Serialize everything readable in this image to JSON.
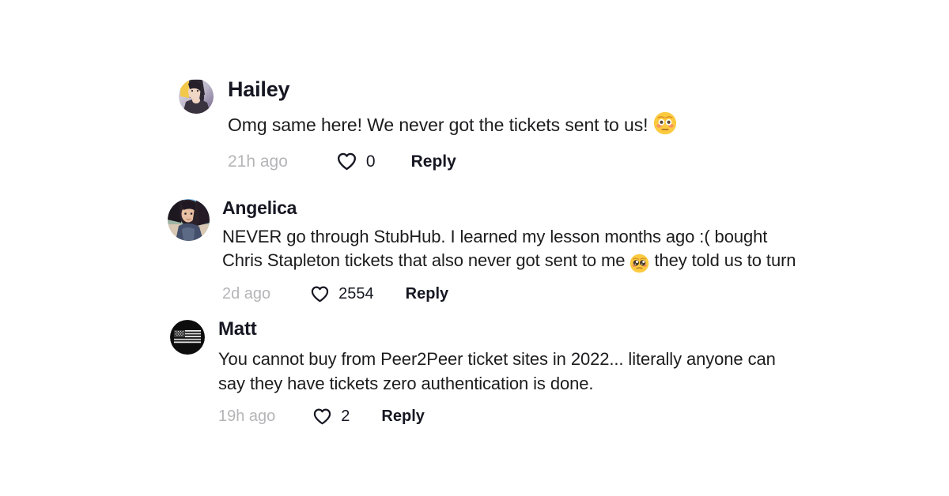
{
  "theme": {
    "background": "#ffffff",
    "author_color": "#161722",
    "text_color": "#1c1c1e",
    "timestamp_color": "#b5b5b8",
    "action_color": "#161722"
  },
  "comments": [
    {
      "author": "Hailey",
      "avatar": "photo-portrait-blonde-dark-avatar",
      "text_before_emoji": "Omg same here! We never got the tickets sent to us! ",
      "emoji": "flushed-face-emoji",
      "text_after_emoji": "",
      "timestamp": "21h ago",
      "like_icon": "heart-outline-icon",
      "like_count": "0",
      "reply_label": "Reply"
    },
    {
      "author": "Angelica",
      "avatar": "photo-selfie-dark-hair-avatar",
      "text_before_emoji": "NEVER go through StubHub. I learned my lesson months ago :( bought Chris Stapleton tickets that also never got sent to me ",
      "emoji": "pleading-face-emoji",
      "text_after_emoji": " they told us to turn",
      "timestamp": "2d ago",
      "like_icon": "heart-outline-icon",
      "like_count": "2554",
      "reply_label": "Reply"
    },
    {
      "author": "Matt",
      "avatar": "american-flag-grayscale-avatar",
      "text_before_emoji": "You cannot buy from Peer2Peer ticket sites in 2022... literally anyone can say they have tickets zero authentication is done.",
      "emoji": null,
      "text_after_emoji": "",
      "timestamp": "19h ago",
      "like_icon": "heart-outline-icon",
      "like_count": "2",
      "reply_label": "Reply"
    }
  ]
}
